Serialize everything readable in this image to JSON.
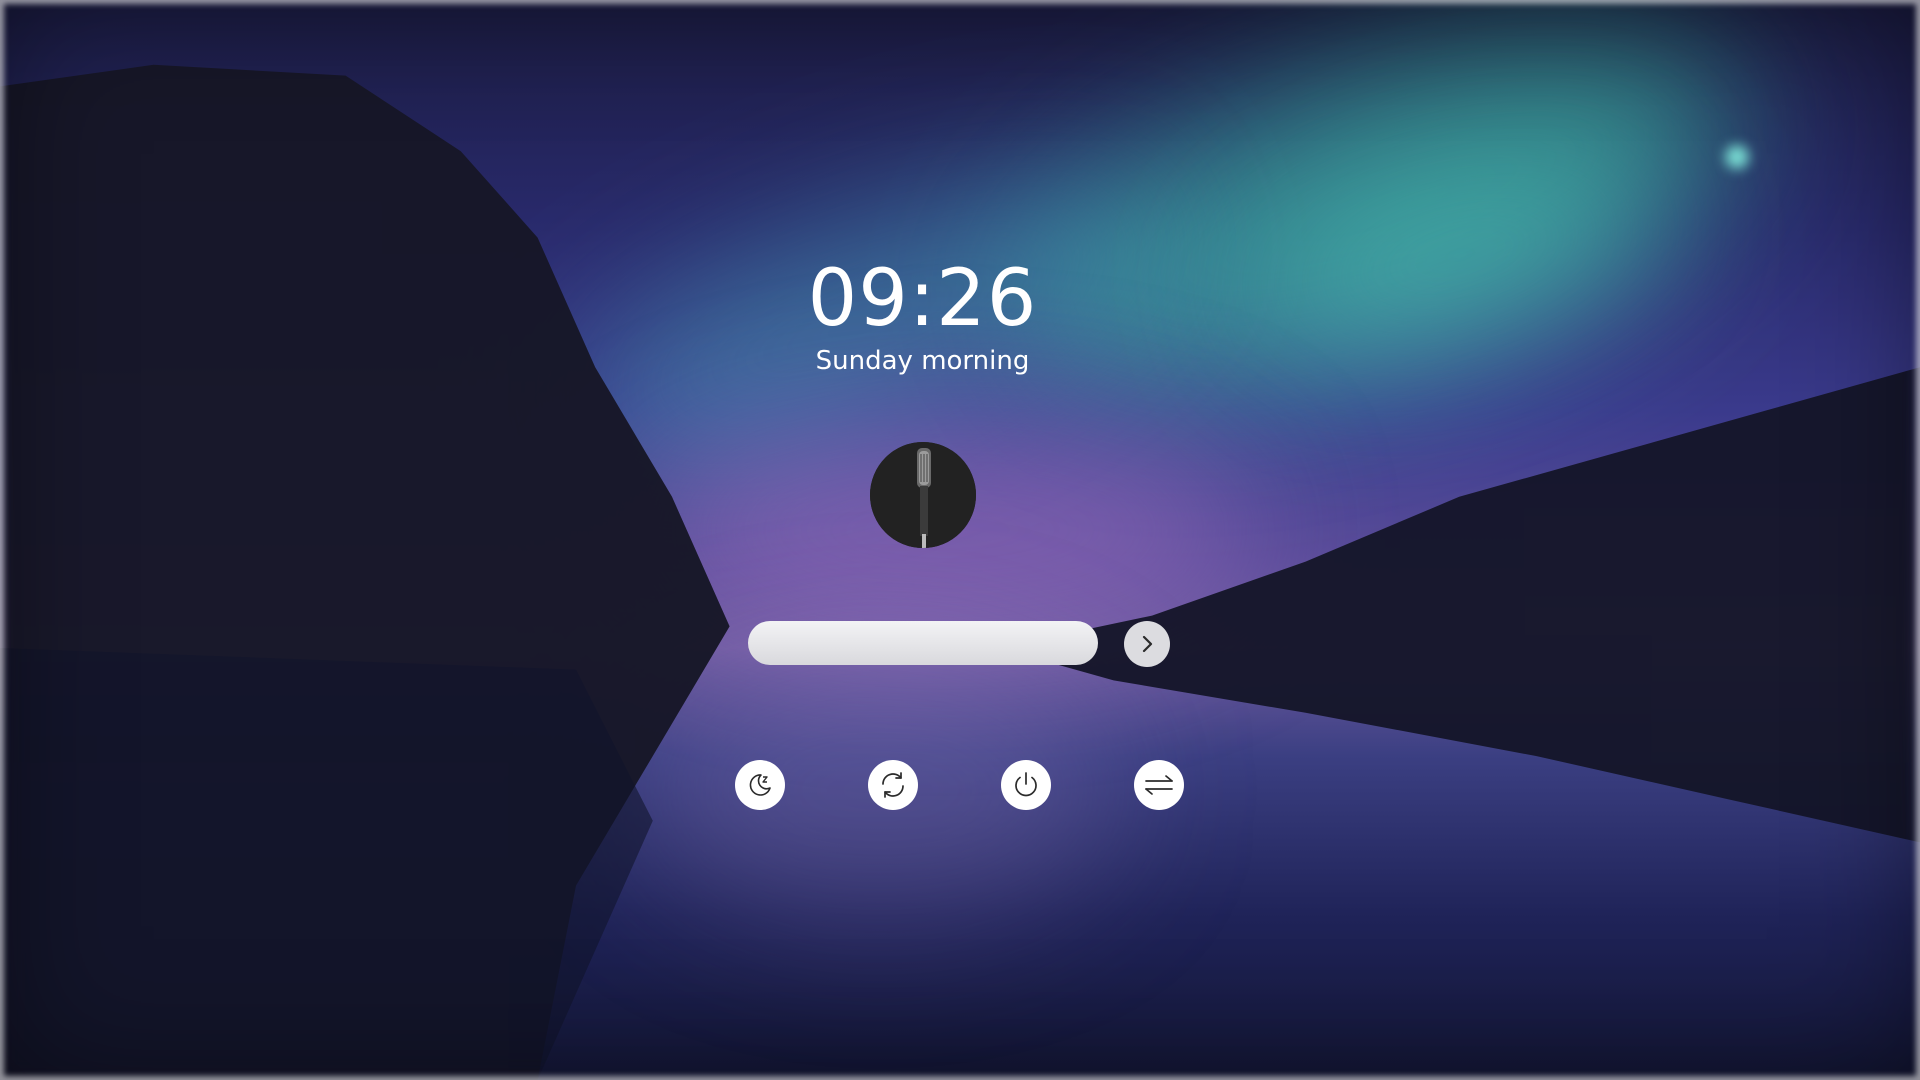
{
  "clock": {
    "time": "09:26",
    "date": "Sunday morning"
  },
  "user": {
    "avatar_icon": "microphone-photo-icon"
  },
  "login": {
    "password_value": "",
    "password_placeholder": "",
    "submit_icon": "chevron-right-icon"
  },
  "actions": [
    {
      "icon": "moon-sleep-icon"
    },
    {
      "icon": "refresh-icon"
    },
    {
      "icon": "power-icon"
    },
    {
      "icon": "switch-user-arrows-icon"
    }
  ],
  "colors": {
    "background": "#1f2358",
    "aurora": "#3cc8aa",
    "button_fill": "#ffffff",
    "icon_stroke": "#2b2b2b"
  }
}
